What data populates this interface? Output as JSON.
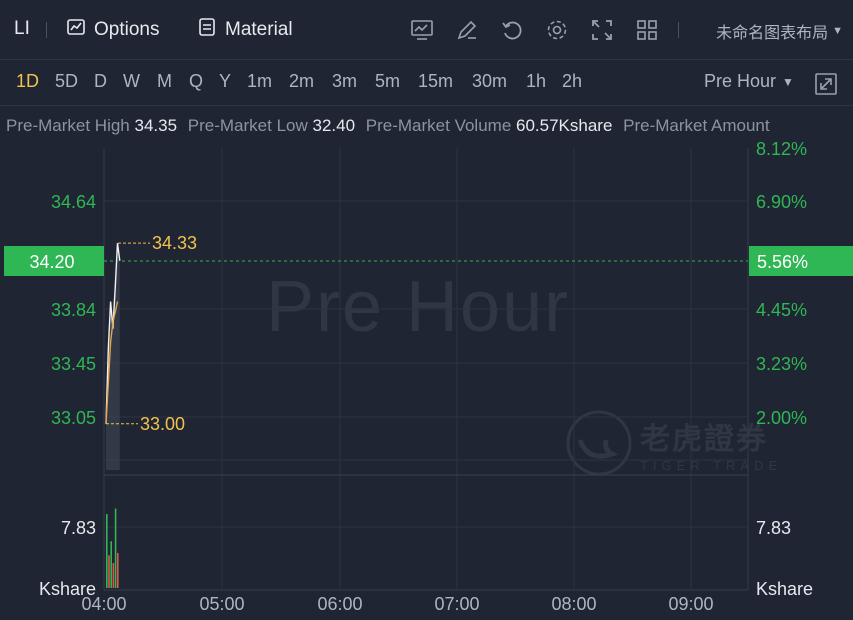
{
  "toolbar": {
    "ticker": "LI",
    "options_label": "Options",
    "material_label": "Material",
    "layout_label": "未命名图表布局",
    "icons": [
      "chart-icon",
      "draw-icon",
      "undo-icon",
      "settings-icon",
      "fullscreen-icon",
      "grid-icon"
    ]
  },
  "periods": [
    "1D",
    "5D",
    "D",
    "W",
    "M",
    "Q",
    "Y",
    "1m",
    "2m",
    "3m",
    "5m",
    "15m",
    "30m",
    "1h",
    "2h"
  ],
  "active_period": "1D",
  "session_label": "Pre Hour",
  "info": {
    "high_label": "Pre-Market High",
    "high_value": "34.35",
    "low_label": "Pre-Market Low",
    "low_value": "32.40",
    "volume_label": "Pre-Market Volume",
    "volume_value": "60.57Kshare",
    "amount_label": "Pre-Market Amount"
  },
  "chart_data": {
    "type": "line",
    "watermark": "Pre Hour",
    "brand_cn": "老虎證券",
    "brand_en": "TIGER TRADE",
    "price_ticks": [
      "34.64",
      "33.84",
      "33.45",
      "33.05"
    ],
    "pct_ticks": [
      "8.12%",
      "6.90%",
      "4.45%",
      "3.23%",
      "2.00%"
    ],
    "current_price": "34.20",
    "current_pct": "5.56%",
    "high_marker": "34.33",
    "low_marker": "33.00",
    "volume_tick_left": "7.83",
    "volume_tick_right": "7.83",
    "volume_unit_left": "Kshare",
    "volume_unit_right": "Kshare",
    "x_ticks": [
      "04:00",
      "05:00",
      "06:00",
      "07:00",
      "08:00",
      "09:00"
    ],
    "price_line": [
      [
        0,
        33.0
      ],
      [
        1,
        33.55
      ],
      [
        2,
        33.9
      ],
      [
        3,
        33.7
      ],
      [
        4,
        34.0
      ],
      [
        5,
        34.33
      ],
      [
        6,
        34.2
      ]
    ],
    "avg_line": [
      [
        0,
        33.0
      ],
      [
        2,
        33.6
      ],
      [
        3,
        33.75
      ],
      [
        4,
        33.82
      ],
      [
        5,
        33.9
      ]
    ],
    "volumes": [
      {
        "v": 9.5,
        "c": "green"
      },
      {
        "v": 4.2,
        "c": "red"
      },
      {
        "v": 6.0,
        "c": "green"
      },
      {
        "v": 3.2,
        "c": "red"
      },
      {
        "v": 10.2,
        "c": "green"
      },
      {
        "v": 4.5,
        "c": "red"
      }
    ],
    "colors": {
      "up": "#2fb655",
      "down": "#e6534f",
      "price_line": "#f2f2f2",
      "avg_line": "#e8a34a",
      "marker": "#f2c14e",
      "accent": "#2fb655"
    }
  }
}
